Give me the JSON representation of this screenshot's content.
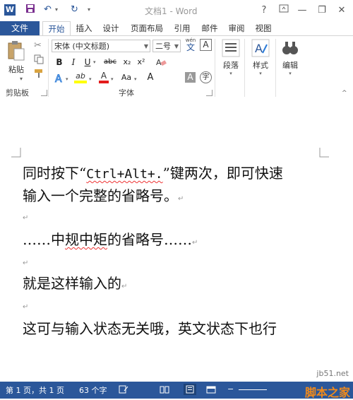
{
  "title_bar": {
    "title": "文档1 - Word",
    "help": "?",
    "minimize": "—",
    "restore": "❐",
    "close": "✕",
    "app_icon": "W"
  },
  "tabs": [
    {
      "label": "文件"
    },
    {
      "label": "开始"
    },
    {
      "label": "插入"
    },
    {
      "label": "设计"
    },
    {
      "label": "页面布局"
    },
    {
      "label": "引用"
    },
    {
      "label": "邮件"
    },
    {
      "label": "审阅"
    },
    {
      "label": "视图"
    }
  ],
  "ribbon": {
    "clipboard": {
      "paste_label": "粘贴",
      "group_label": "剪贴板"
    },
    "font": {
      "font_name": "宋体 (中文标题)",
      "font_size": "二号",
      "wen_label": "wén",
      "wen_char": "文",
      "a_box": "A",
      "bold": "B",
      "italic": "I",
      "underline": "U",
      "strike": "abc",
      "subscript": "x₂",
      "superscript": "x²",
      "aa": "Aa",
      "grow": "A",
      "font_color": "A",
      "highlight": "ab",
      "shade_a": "A",
      "circle_char": "字",
      "group_label": "字体"
    },
    "paragraph": {
      "label": "段落"
    },
    "styles": {
      "label": "样式"
    },
    "editing": {
      "label": "编辑"
    }
  },
  "document": {
    "line1_a": "同时按下“",
    "line1_keys": "Ctrl+Alt+.",
    "line1_b": "”键两次，即可快速",
    "line2": "输入一个完整的省略号。",
    "line3_a": "……中",
    "line3_sq": "规中矩",
    "line3_b": "的省略号……",
    "line4": "就是这样输入的",
    "line5": "这可与输入状态无关哦，英文状态下也行",
    "para_mark": "↵"
  },
  "status_bar": {
    "page": "第 1 页，共 1 页",
    "words": "63 个字",
    "watermark": "脚本之家",
    "watermark_url": "jb51.net"
  },
  "colors": {
    "accent": "#2b579a",
    "squiggle": "#e33333"
  }
}
